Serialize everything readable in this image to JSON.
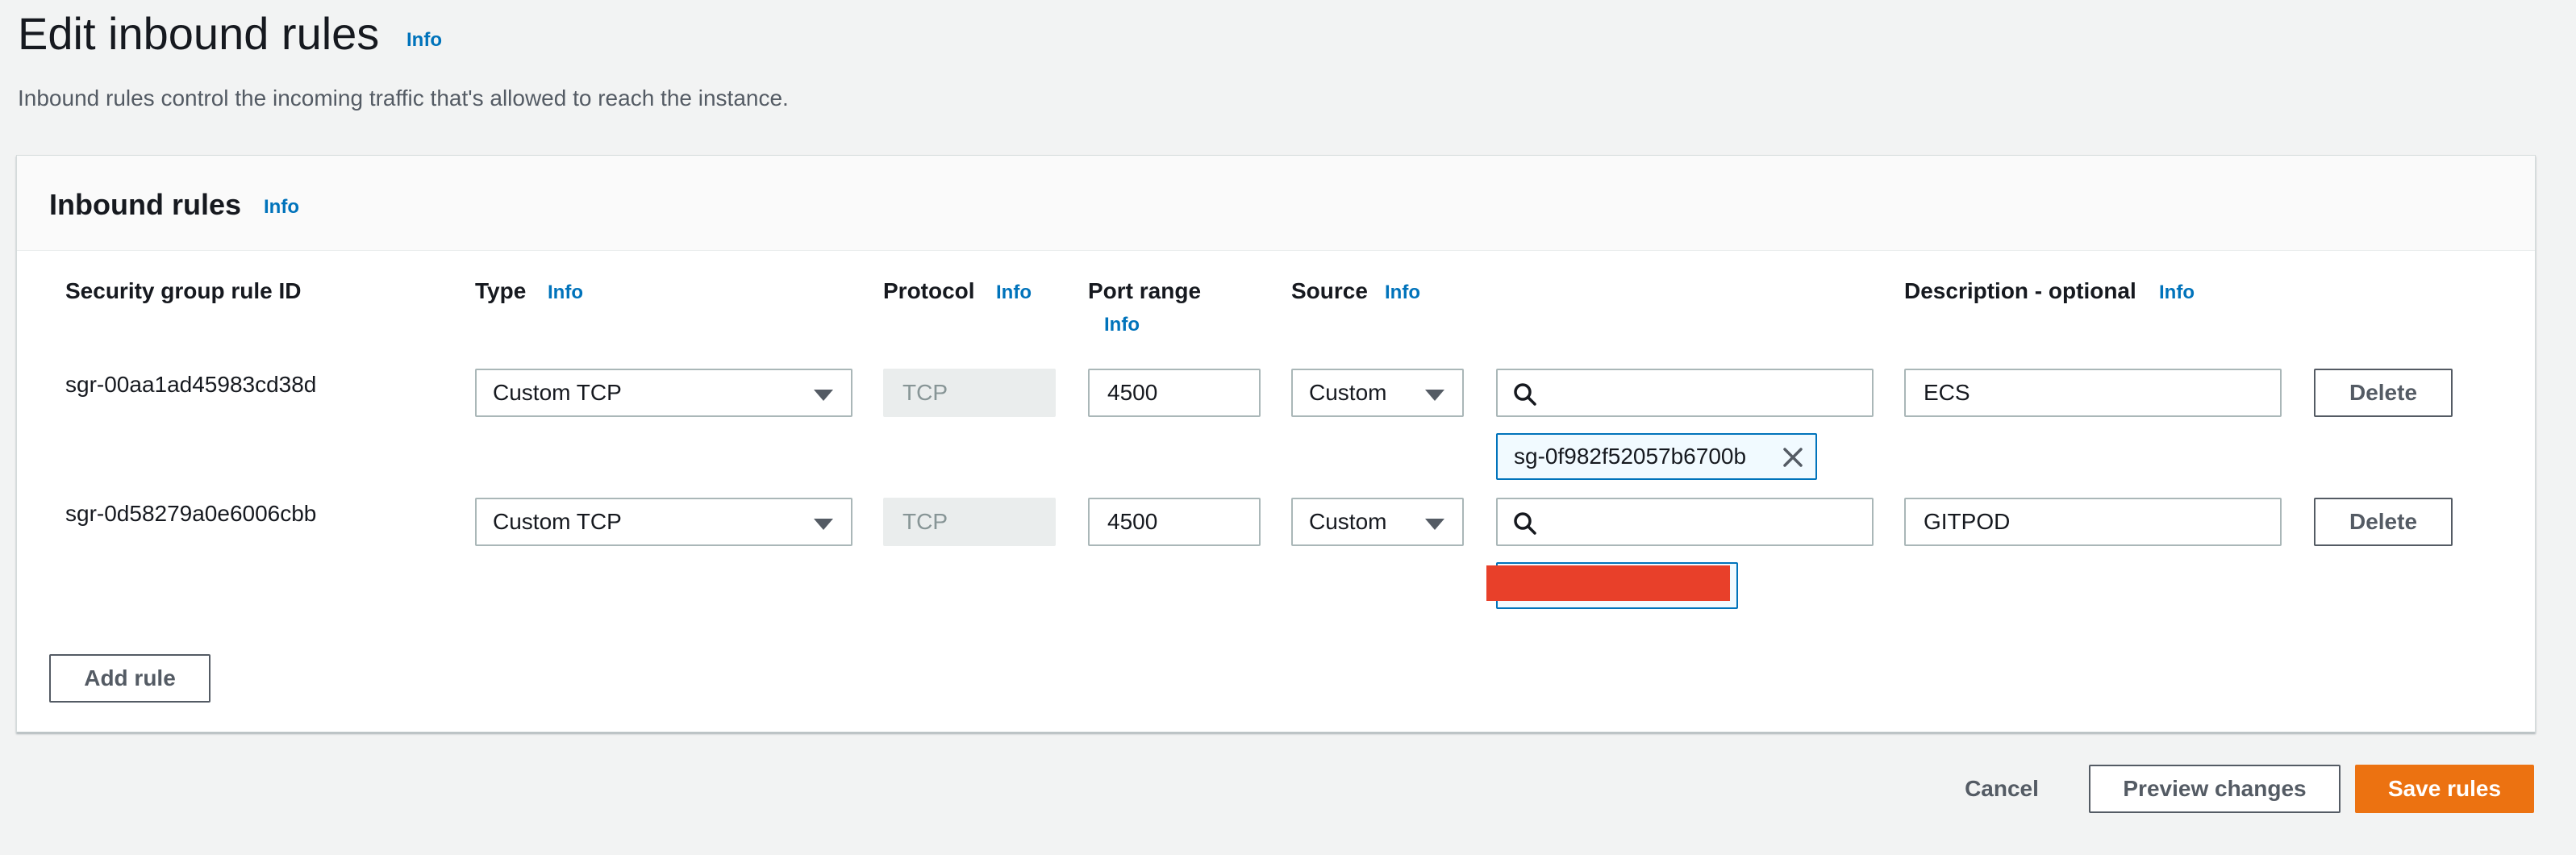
{
  "page": {
    "title": "Edit inbound rules",
    "title_info": "Info",
    "description": "Inbound rules control the incoming traffic that's allowed to reach the instance."
  },
  "panel": {
    "title": "Inbound rules",
    "title_info": "Info"
  },
  "columns": {
    "rule_id": "Security group rule ID",
    "type": "Type",
    "type_info": "Info",
    "protocol": "Protocol",
    "protocol_info": "Info",
    "port_range": "Port range",
    "port_range_info": "Info",
    "source": "Source",
    "source_info": "Info",
    "description": "Description - optional",
    "description_info": "Info"
  },
  "rules": [
    {
      "id": "sgr-00aa1ad45983cd38d",
      "type": "Custom TCP",
      "protocol": "TCP",
      "port_range": "4500",
      "source": "Custom",
      "source_token": "sg-0f982f52057b6700b",
      "description": "ECS",
      "delete_label": "Delete"
    },
    {
      "id": "sgr-0d58279a0e6006cbb",
      "type": "Custom TCP",
      "protocol": "TCP",
      "port_range": "4500",
      "source": "Custom",
      "source_token": "",
      "description": "GITPOD",
      "delete_label": "Delete"
    }
  ],
  "actions": {
    "add_rule": "Add rule",
    "cancel": "Cancel",
    "preview": "Preview changes",
    "save": "Save rules"
  },
  "icons": {
    "search": "search-icon",
    "close": "close-icon",
    "caret": "caret-down-icon"
  },
  "colors": {
    "link": "#0073bb",
    "primary": "#ec7211",
    "redaction": "#e8402a",
    "token_border": "#0073bb"
  }
}
